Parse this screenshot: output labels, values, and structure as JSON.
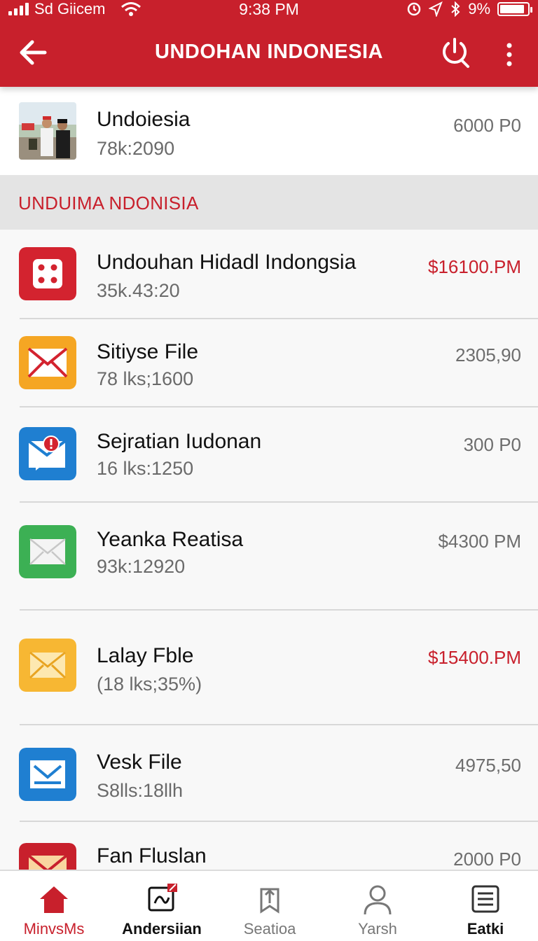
{
  "status_bar": {
    "carrier": "Sd Giicem",
    "time": "9:38 PM",
    "battery": "9%",
    "battery_level": 0.9
  },
  "app_bar": {
    "title": "UNDOHAN INDONESIA",
    "back_icon": "arrow-left-icon",
    "power_icon": "power-search-icon",
    "more_icon": "more-vertical-icon"
  },
  "top_item": {
    "title": "Undoiesia",
    "subtitle": "78k:2090",
    "value": "6000 P0"
  },
  "section_header": "UNDUIMA NDONISIA",
  "items": [
    {
      "title": "Undouhan Hidadl Indongsia",
      "subtitle": "35k.43:20",
      "value": "$16100.PM",
      "value_color": "#c8202c",
      "icon": "dice-icon",
      "icon_color": "#d3232f"
    },
    {
      "title": "Sitiyse File",
      "subtitle": "78 lks;1600",
      "value": "2305,90",
      "value_color": "#6d6d6d",
      "icon": "envelope-icon",
      "icon_color": "#f5a623"
    },
    {
      "title": "Sejratian Iudonan",
      "subtitle": "16 lks:1250",
      "value": "300 P0",
      "value_color": "#6d6d6d",
      "icon": "message-alert-icon",
      "icon_color": "#1f7fd1"
    },
    {
      "title": "Yeanka Reatisa",
      "subtitle": "93k:12920",
      "value": "$4300 PM",
      "value_color": "#6d6d6d",
      "icon": "envelope-icon",
      "icon_color": "#3cb054"
    },
    {
      "title": "Lalay Fble",
      "subtitle": "(18 lks;35%)",
      "value": "$15400.PM",
      "value_color": "#c8202c",
      "icon": "envelope-icon",
      "icon_color": "#f7b733"
    },
    {
      "title": "Vesk File",
      "subtitle": "S8lls:18llh",
      "value": "4975,50",
      "value_color": "#6d6d6d",
      "icon": "inbox-icon",
      "icon_color": "#1f7fd1"
    },
    {
      "title": "Fan Fluslan",
      "subtitle": "",
      "value": "2000 P0",
      "value_color": "#6d6d6d",
      "icon": "envelope-icon",
      "icon_color": "#c8202c"
    }
  ],
  "bottom_nav": [
    {
      "label": "MinvsMs",
      "icon": "home-icon",
      "active": true
    },
    {
      "label": "Andersiian",
      "icon": "edit-image-icon",
      "active": false
    },
    {
      "label": "Seatioa",
      "icon": "bookmark-upload-icon",
      "active": false
    },
    {
      "label": "Yarsh",
      "icon": "person-icon",
      "active": false
    },
    {
      "label": "Eatki",
      "icon": "list-icon",
      "active": false
    }
  ]
}
